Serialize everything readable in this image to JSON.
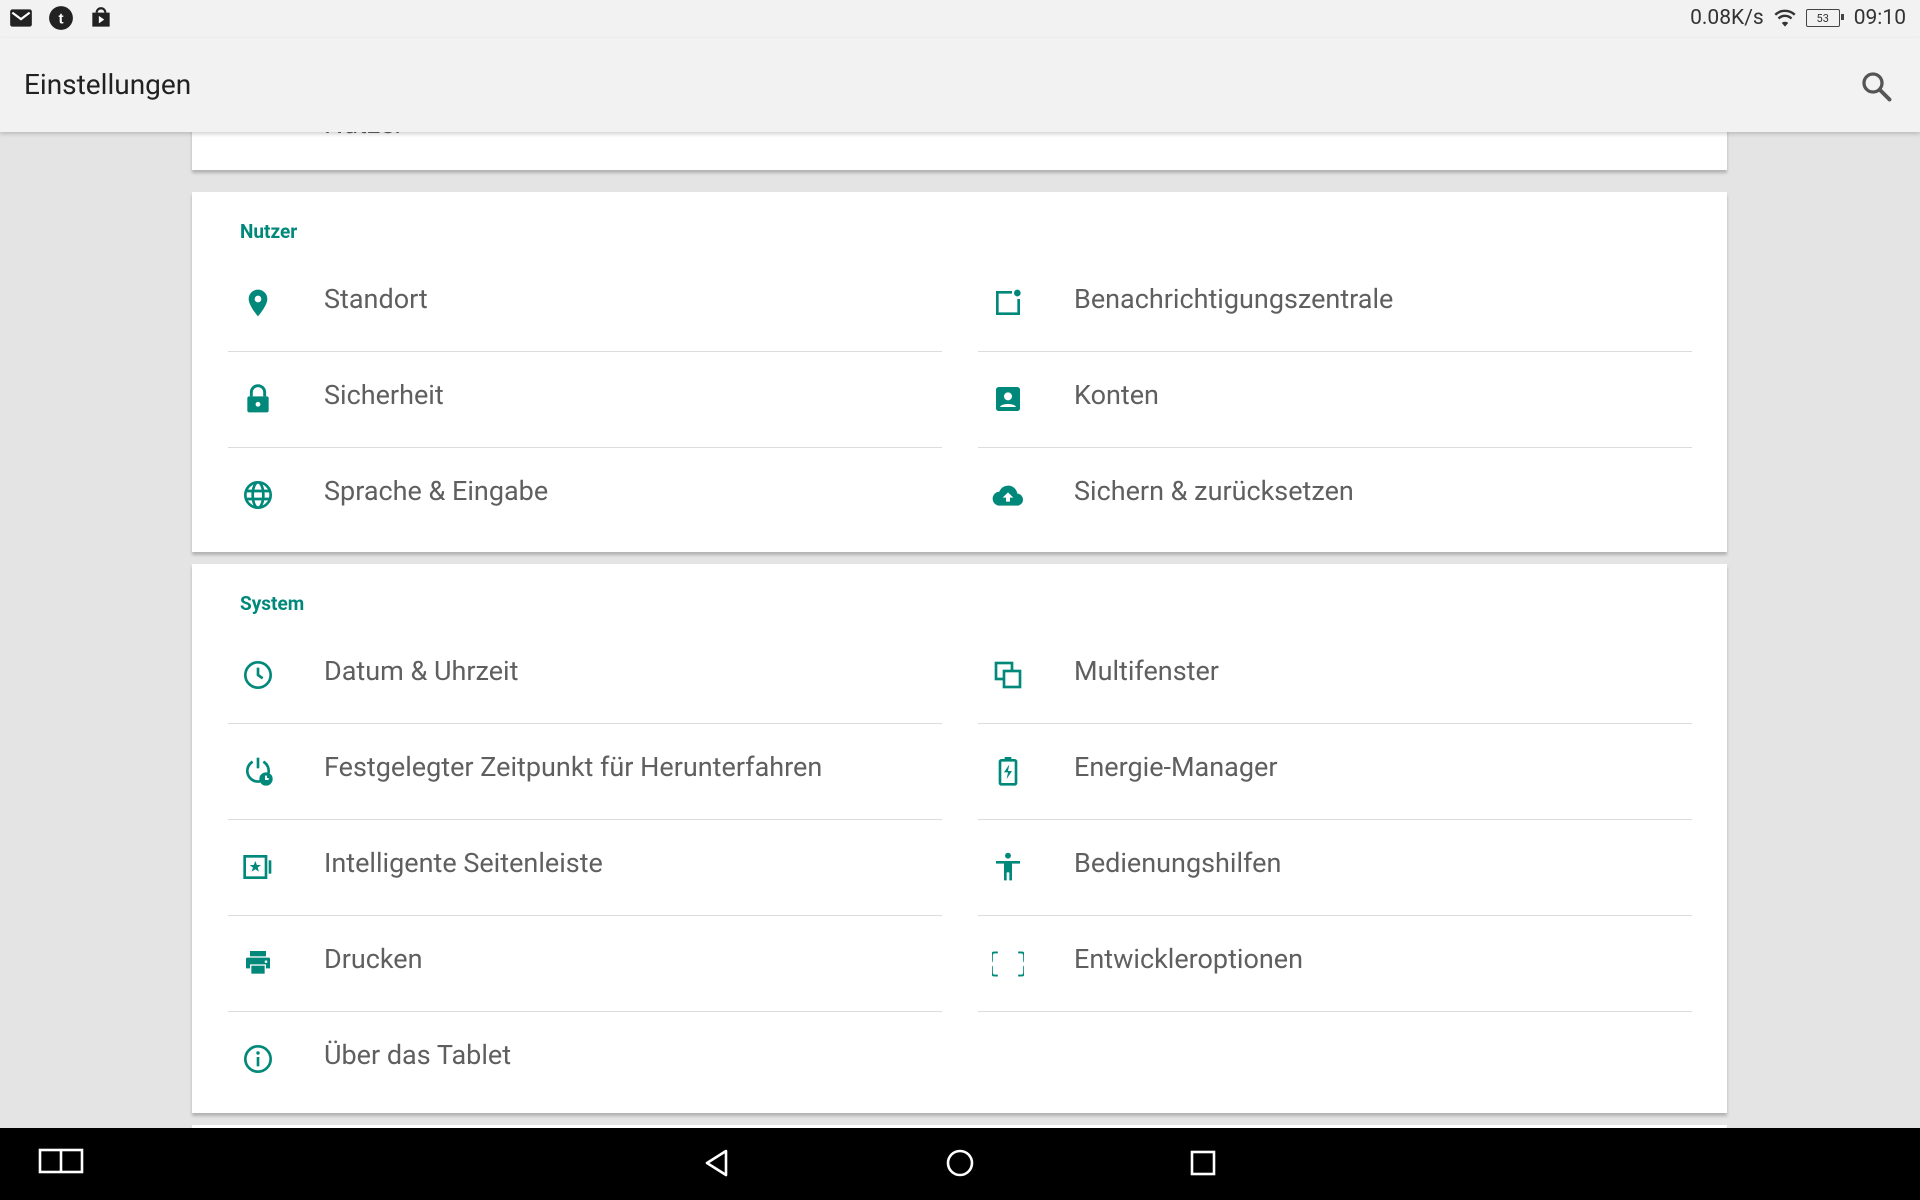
{
  "status_bar": {
    "notification_icons": [
      "gmail-icon",
      "tumblr-icon",
      "play-store-icon"
    ],
    "net_speed": "0.08K/s",
    "battery": "53",
    "time": "09:10"
  },
  "app_bar": {
    "title": "Einstellungen",
    "search_icon": "search-icon"
  },
  "previous_item_label": "Nutzer",
  "sections": [
    {
      "title": "Nutzer",
      "items": [
        {
          "label": "Standort",
          "icon": "location-icon"
        },
        {
          "label": "Benachrichtigungszentrale",
          "icon": "notification-center-icon"
        },
        {
          "label": "Sicherheit",
          "icon": "lock-icon"
        },
        {
          "label": "Konten",
          "icon": "account-icon"
        },
        {
          "label": "Sprache & Eingabe",
          "icon": "globe-icon"
        },
        {
          "label": "Sichern & zurücksetzen",
          "icon": "cloud-upload-icon"
        }
      ]
    },
    {
      "title": "System",
      "items": [
        {
          "label": "Datum & Uhrzeit",
          "icon": "clock-icon"
        },
        {
          "label": "Multifenster",
          "icon": "multiwindow-icon"
        },
        {
          "label": "Festgelegter Zeitpunkt für Herunterfahren",
          "icon": "scheduled-power-icon"
        },
        {
          "label": "Energie-Manager",
          "icon": "battery-charging-icon"
        },
        {
          "label": "Intelligente Seitenleiste",
          "icon": "smart-sidebar-icon"
        },
        {
          "label": "Bedienungshilfen",
          "icon": "accessibility-icon"
        },
        {
          "label": "Drucken",
          "icon": "printer-icon"
        },
        {
          "label": "Entwickleroptionen",
          "icon": "code-braces-icon"
        },
        {
          "label": "Über das Tablet",
          "icon": "info-icon"
        }
      ]
    }
  ],
  "nav_bar": [
    "split-screen-icon",
    "back-icon",
    "home-icon",
    "recents-icon"
  ],
  "colors": {
    "accent": "#00897b",
    "text": "#5f5f5f",
    "background": "#e4e4e4"
  }
}
